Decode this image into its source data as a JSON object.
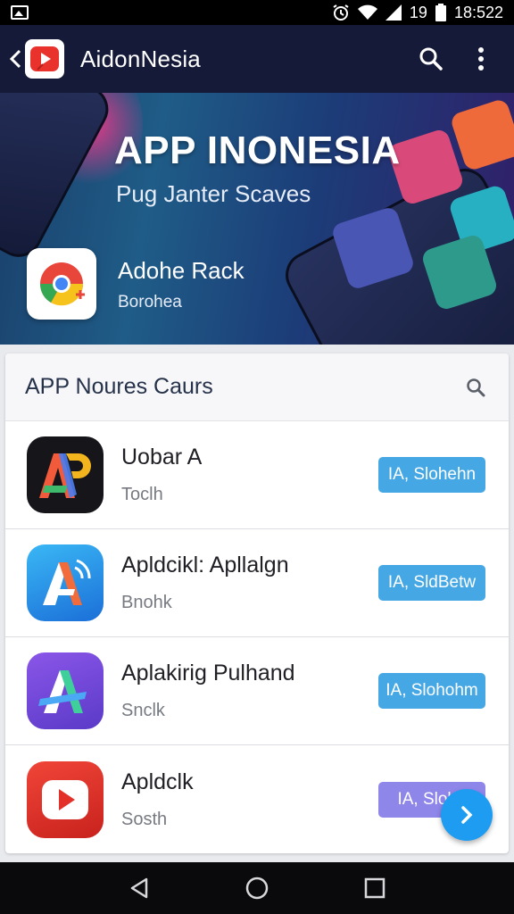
{
  "status_bar": {
    "left_icon": "image-icon",
    "signal_text": "19",
    "time": "18:522"
  },
  "app_bar": {
    "title": "AidonNesia",
    "icons": [
      "back-icon",
      "youtube-play-icon",
      "search-icon",
      "more-vert-icon"
    ]
  },
  "banner": {
    "title": "APP INONESIA",
    "subtitle": "Pug Janter Scaves",
    "featured_app": {
      "name": "Adohe Rack",
      "subtitle": "Borohea",
      "icon": "chrome-icon"
    }
  },
  "list": {
    "header": "APP Noures Caurs",
    "items": [
      {
        "name": "Uobar A",
        "sub": "Toclh",
        "button": "IA, Slohehn",
        "icon": "ap-logo-icon"
      },
      {
        "name": "Apldcikl: Apllalgn",
        "sub": "Bnohk",
        "button": "IA, SldBetw",
        "icon": "a-sound-icon"
      },
      {
        "name": "Aplakirig Pulhand",
        "sub": "Snclk",
        "button": "IA, Slohohm",
        "icon": "a-purple-icon"
      },
      {
        "name": "Apldclk",
        "sub": "Sosth",
        "button": "IA, Slohd",
        "icon": "play-icon"
      }
    ]
  },
  "colors": {
    "app_bar": "#151a38",
    "install_button": "#45a8e5",
    "fab": "#1d9cf2"
  }
}
